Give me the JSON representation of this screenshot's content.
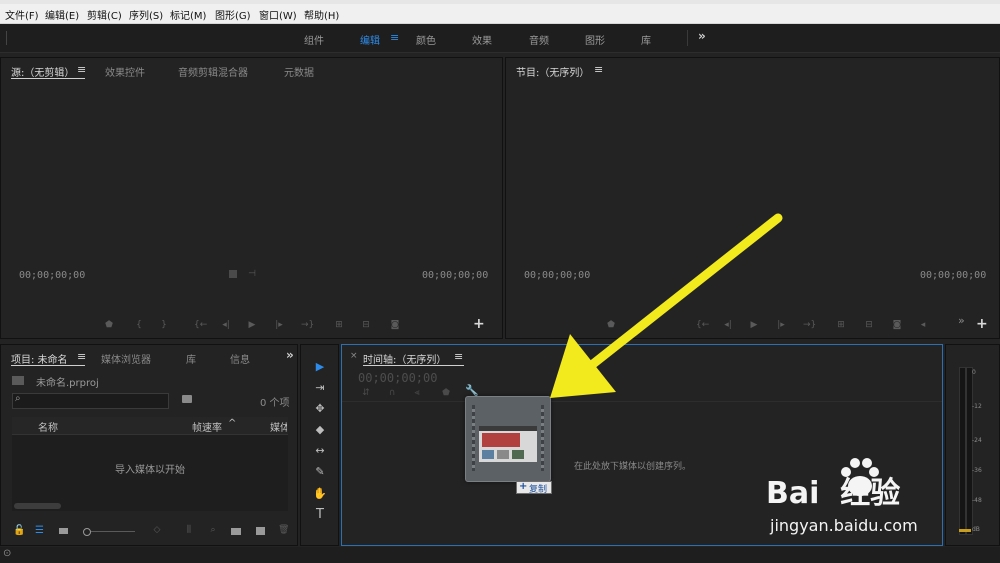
{
  "menu": [
    "文件(F)",
    "编辑(E)",
    "剪辑(C)",
    "序列(S)",
    "标记(M)",
    "图形(G)",
    "窗口(W)",
    "帮助(H)"
  ],
  "workspaces": [
    "组件",
    "编辑",
    "颜色",
    "效果",
    "音频",
    "图形",
    "库"
  ],
  "workspace_active": "编辑",
  "more_glyph": "»",
  "source_panel": {
    "tabs": [
      "源:（无剪辑）",
      "效果控件",
      "音频剪辑混合器",
      "元数据"
    ],
    "timecode_left": "00;00;00;00",
    "timecode_right": "00;00;00;00",
    "add_glyph": "+"
  },
  "program_panel": {
    "title": "节目:（无序列）",
    "timecode_left": "00;00;00;00",
    "timecode_right": "00;00;00;00",
    "add_glyph": "+"
  },
  "project_panel": {
    "tabs": [
      "项目: 未命名",
      "媒体浏览器",
      "库",
      "信息"
    ],
    "file": "未命名.prproj",
    "item_count": "0 个项",
    "col_name": "名称",
    "col_fps": "帧速率",
    "col_media": "媒体",
    "import_hint": "导入媒体以开始"
  },
  "timeline_panel": {
    "close": "×",
    "title": "时间轴:（无序列）",
    "timecode": "00;00;00;00",
    "drop_hint": "在此处放下媒体以创建序列。",
    "copy_badge": "复制"
  },
  "tools": [
    "▶",
    "⇥",
    "✥",
    "◆",
    "↔",
    "✎",
    "✋",
    "T"
  ],
  "meter_ticks": [
    "0",
    "-12",
    "-24",
    "-36",
    "-48",
    "dB"
  ],
  "watermark": {
    "brand": "Bai  经验",
    "url": "jingyan.baidu.com"
  },
  "colors": {
    "accent": "#2d8ceb",
    "arrow": "#f2ea1d",
    "background": "#232323"
  }
}
